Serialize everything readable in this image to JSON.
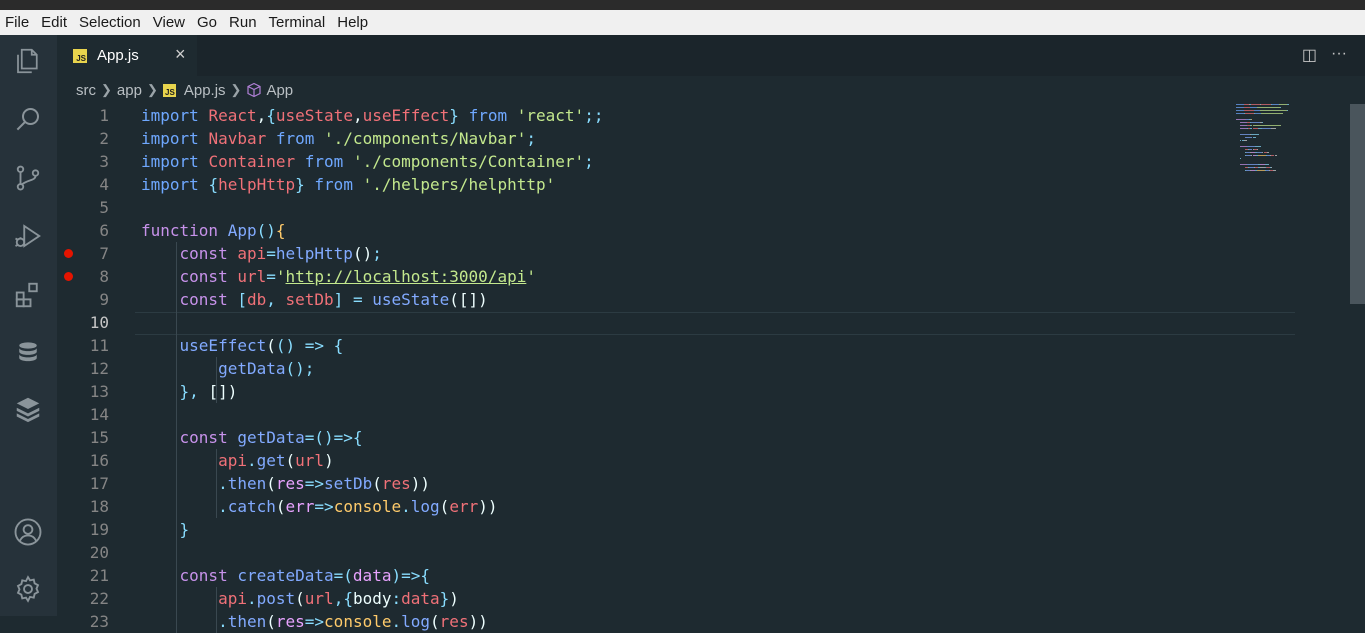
{
  "menu": [
    "File",
    "Edit",
    "Selection",
    "View",
    "Go",
    "Run",
    "Terminal",
    "Help"
  ],
  "activity_bar": [
    "explorer-icon",
    "search-icon",
    "source-control-icon",
    "run-debug-icon",
    "extensions-icon",
    "database-icon",
    "layers-icon",
    "account-icon",
    "settings-gear-icon"
  ],
  "tab": {
    "badge": "JS",
    "label": "App.js",
    "close": "×"
  },
  "tab_actions": {
    "split": "◫",
    "more": "···"
  },
  "breadcrumb": {
    "src": "src",
    "app": "app",
    "file": "App.js",
    "symbol": "App"
  },
  "editor": {
    "active_line": 10,
    "breakpoint_lines": [
      7,
      8
    ],
    "lines": [
      {
        "n": "1",
        "tokens": [
          [
            "import ",
            "kb"
          ],
          [
            "React",
            "v"
          ],
          [
            ",",
            "w"
          ],
          [
            "{",
            "p"
          ],
          [
            "useState",
            "v"
          ],
          [
            ",",
            "w"
          ],
          [
            "useEffect",
            "v"
          ],
          [
            "}",
            "p"
          ],
          [
            " from ",
            "kb"
          ],
          [
            "'",
            "s"
          ],
          [
            "react",
            "s"
          ],
          [
            "'",
            "s"
          ],
          [
            ";;",
            "p"
          ]
        ]
      },
      {
        "n": "2",
        "tokens": [
          [
            "import ",
            "kb"
          ],
          [
            "Navbar",
            "v"
          ],
          [
            " from ",
            "kb"
          ],
          [
            "'./components/Navbar'",
            "s"
          ],
          [
            ";",
            "p"
          ]
        ]
      },
      {
        "n": "3",
        "tokens": [
          [
            "import ",
            "kb"
          ],
          [
            "Container",
            "v"
          ],
          [
            " from ",
            "kb"
          ],
          [
            "'./components/Container'",
            "s"
          ],
          [
            ";",
            "p"
          ]
        ]
      },
      {
        "n": "4",
        "tokens": [
          [
            "import ",
            "kb"
          ],
          [
            "{",
            "p"
          ],
          [
            "helpHttp",
            "v"
          ],
          [
            "}",
            "p"
          ],
          [
            " from ",
            "kb"
          ],
          [
            "'./helpers/helphttp'",
            "s"
          ]
        ]
      },
      {
        "n": "5",
        "tokens": []
      },
      {
        "n": "6",
        "tokens": [
          [
            "function ",
            "k"
          ],
          [
            "App",
            "f"
          ],
          [
            "()",
            "p"
          ],
          [
            "{",
            "y"
          ]
        ]
      },
      {
        "n": "7",
        "tokens": [
          [
            "    ",
            " "
          ],
          [
            "const ",
            "k"
          ],
          [
            "api",
            "v"
          ],
          [
            "=",
            "p"
          ],
          [
            "helpHttp",
            "f"
          ],
          [
            "()",
            "w"
          ],
          [
            ";",
            "p"
          ]
        ]
      },
      {
        "n": "8",
        "tokens": [
          [
            "    ",
            " "
          ],
          [
            "const ",
            "k"
          ],
          [
            "url",
            "v"
          ],
          [
            "=",
            "p"
          ],
          [
            "'",
            "s"
          ],
          [
            "http://localhost:3000/api",
            "su"
          ],
          [
            "'",
            "s"
          ]
        ]
      },
      {
        "n": "9",
        "tokens": [
          [
            "    ",
            " "
          ],
          [
            "const ",
            "k"
          ],
          [
            "[",
            "p"
          ],
          [
            "db",
            "v"
          ],
          [
            ", ",
            "p"
          ],
          [
            "setDb",
            "v"
          ],
          [
            "]",
            "p"
          ],
          [
            " = ",
            "p"
          ],
          [
            "useState",
            "f"
          ],
          [
            "([])",
            "w"
          ]
        ]
      },
      {
        "n": "10",
        "tokens": []
      },
      {
        "n": "11",
        "tokens": [
          [
            "    ",
            " "
          ],
          [
            "useEffect",
            "f"
          ],
          [
            "(",
            "w"
          ],
          [
            "() => {",
            "p"
          ]
        ]
      },
      {
        "n": "12",
        "tokens": [
          [
            "        ",
            " "
          ],
          [
            "getData",
            "f"
          ],
          [
            "()",
            "p"
          ],
          [
            ";",
            "p"
          ]
        ]
      },
      {
        "n": "13",
        "tokens": [
          [
            "    ",
            " "
          ],
          [
            "}",
            "p"
          ],
          [
            ", ",
            "p"
          ],
          [
            "[])",
            "w"
          ]
        ]
      },
      {
        "n": "14",
        "tokens": []
      },
      {
        "n": "15",
        "tokens": [
          [
            "    ",
            " "
          ],
          [
            "const ",
            "k"
          ],
          [
            "getData",
            "f"
          ],
          [
            "=()=>{",
            "p"
          ]
        ]
      },
      {
        "n": "16",
        "tokens": [
          [
            "        ",
            " "
          ],
          [
            "api",
            "v"
          ],
          [
            ".",
            "p"
          ],
          [
            "get",
            "f"
          ],
          [
            "(",
            "w"
          ],
          [
            "url",
            "v"
          ],
          [
            ")",
            "w"
          ]
        ]
      },
      {
        "n": "17",
        "tokens": [
          [
            "        ",
            " "
          ],
          [
            ".",
            "p"
          ],
          [
            "then",
            "f"
          ],
          [
            "(",
            "w"
          ],
          [
            "res",
            "pr"
          ],
          [
            "=>",
            "p"
          ],
          [
            "setDb",
            "f"
          ],
          [
            "(",
            "w"
          ],
          [
            "res",
            "v"
          ],
          [
            "))",
            "w"
          ]
        ]
      },
      {
        "n": "18",
        "tokens": [
          [
            "        ",
            " "
          ],
          [
            ".",
            "p"
          ],
          [
            "catch",
            "f"
          ],
          [
            "(",
            "w"
          ],
          [
            "err",
            "pr"
          ],
          [
            "=>",
            "p"
          ],
          [
            "console",
            "y"
          ],
          [
            ".",
            "p"
          ],
          [
            "log",
            "f"
          ],
          [
            "(",
            "w"
          ],
          [
            "err",
            "v"
          ],
          [
            "))",
            "w"
          ]
        ]
      },
      {
        "n": "19",
        "tokens": [
          [
            "    ",
            " "
          ],
          [
            "}",
            "p"
          ]
        ]
      },
      {
        "n": "20",
        "tokens": []
      },
      {
        "n": "21",
        "tokens": [
          [
            "    ",
            " "
          ],
          [
            "const ",
            "k"
          ],
          [
            "createData",
            "f"
          ],
          [
            "=(",
            "p"
          ],
          [
            "data",
            "pr"
          ],
          [
            ")=>{",
            "p"
          ]
        ]
      },
      {
        "n": "22",
        "tokens": [
          [
            "        ",
            " "
          ],
          [
            "api",
            "v"
          ],
          [
            ".",
            "p"
          ],
          [
            "post",
            "f"
          ],
          [
            "(",
            "w"
          ],
          [
            "url",
            "v"
          ],
          [
            ",{",
            "p"
          ],
          [
            "body",
            "w"
          ],
          [
            ":",
            "p"
          ],
          [
            "data",
            "v"
          ],
          [
            "}",
            "p"
          ],
          [
            ")",
            "w"
          ]
        ]
      },
      {
        "n": "23",
        "tokens": [
          [
            "        ",
            " "
          ],
          [
            ".",
            "p"
          ],
          [
            "then",
            "f"
          ],
          [
            "(",
            "w"
          ],
          [
            "res",
            "pr"
          ],
          [
            "=>",
            "p"
          ],
          [
            "console",
            "y"
          ],
          [
            ".",
            "p"
          ],
          [
            "log",
            "f"
          ],
          [
            "(",
            "w"
          ],
          [
            "res",
            "v"
          ],
          [
            "))",
            "w"
          ]
        ]
      }
    ]
  }
}
